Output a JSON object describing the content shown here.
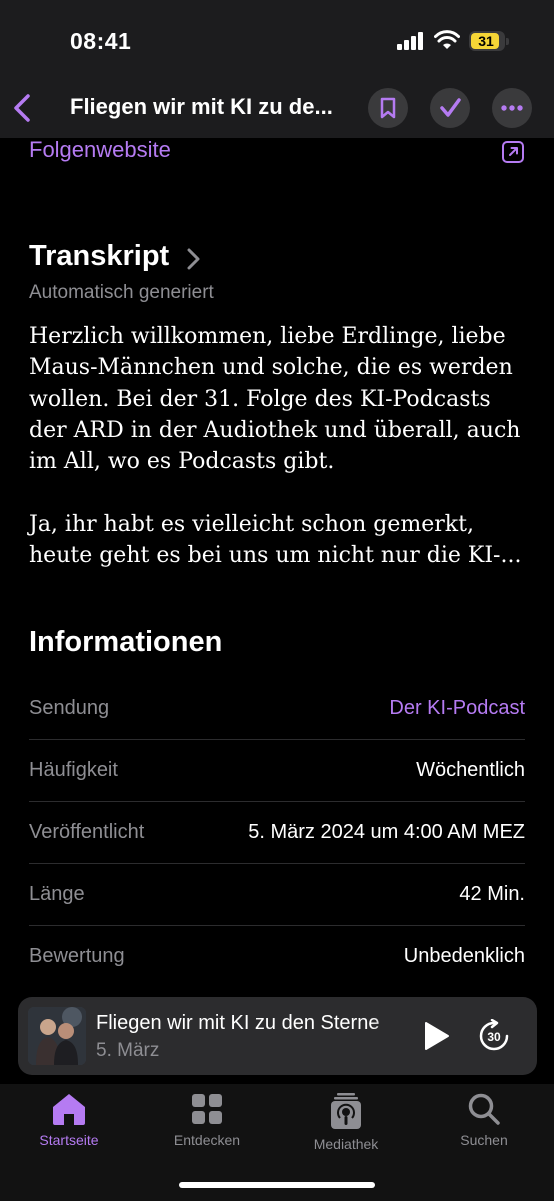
{
  "status_bar": {
    "time": "08:41",
    "battery_level": "31",
    "battery_color": "#f5d536"
  },
  "nav": {
    "back_icon": "chevron-left-icon",
    "title": "Fliegen wir mit KI zu de...",
    "bookmark_icon": "bookmark-icon",
    "played_icon": "checkmark-icon",
    "more_icon": "ellipsis-icon"
  },
  "episode": {
    "website_link": "Folgenwebsite",
    "external_icon": "external-link-icon"
  },
  "transcript": {
    "title": "Transkript",
    "subtitle": "Automatisch generiert",
    "paragraph1": "Herzlich willkommen, liebe Erdlinge, liebe Maus-Männchen und solche, die es werden wollen. Bei der 31. Folge des KI-Podcasts der ARD in der Audiothek und überall, auch im All, wo es Podcasts gibt.",
    "paragraph2": "Ja, ihr habt es vielleicht schon gemerkt, heute geht es bei uns um nicht nur die KI-..."
  },
  "information": {
    "title": "Informationen",
    "rows": [
      {
        "label": "Sendung",
        "value": "Der KI-Podcast"
      },
      {
        "label": "Häufigkeit",
        "value": "Wöchentlich"
      },
      {
        "label": "Veröffentlicht",
        "value": "5. März 2024 um 4:00 AM MEZ"
      },
      {
        "label": "Länge",
        "value": "42 Min."
      },
      {
        "label": "Bewertung",
        "value": "Unbedenklich"
      }
    ]
  },
  "mini_player": {
    "title": "Fliegen wir mit KI zu den Sterne",
    "date": "5. März",
    "play_icon": "play-icon",
    "skip_label": "30",
    "skip_icon": "skip-forward-30-icon"
  },
  "tab_bar": {
    "tabs": [
      {
        "label": "Startseite",
        "icon": "home-icon",
        "active": true
      },
      {
        "label": "Entdecken",
        "icon": "grid-icon",
        "active": false
      },
      {
        "label": "Mediathek",
        "icon": "library-icon",
        "active": false
      },
      {
        "label": "Suchen",
        "icon": "search-icon",
        "active": false
      }
    ]
  },
  "colors": {
    "accent": "#b57bf2",
    "secondary_text": "#8e8e93",
    "background": "#000000",
    "bar_background": "#1c1c1e"
  }
}
